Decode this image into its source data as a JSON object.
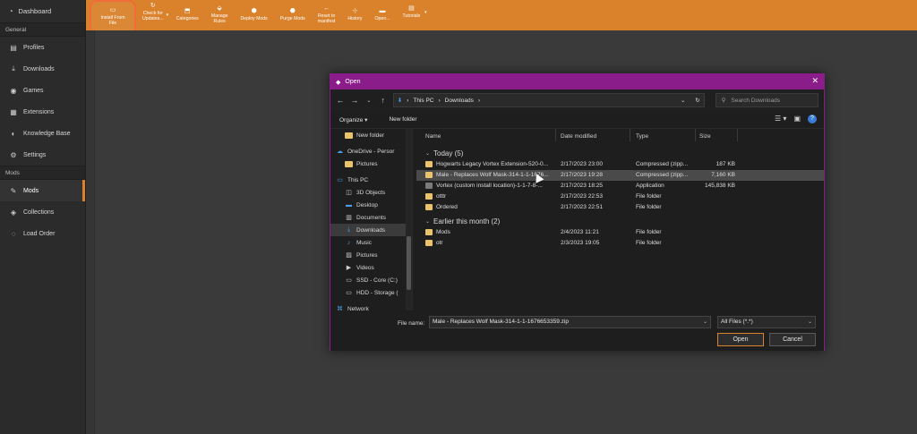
{
  "sidebar": {
    "top": "Dashboard",
    "general_label": "General",
    "general_items": [
      {
        "label": "Profiles",
        "icon": "profiles-icon"
      },
      {
        "label": "Downloads",
        "icon": "downloads-icon"
      },
      {
        "label": "Games",
        "icon": "games-icon"
      },
      {
        "label": "Extensions",
        "icon": "extensions-icon"
      },
      {
        "label": "Knowledge Base",
        "icon": "knowledge-icon"
      },
      {
        "label": "Settings",
        "icon": "gear-icon"
      }
    ],
    "mods_label": "Mods",
    "mods_items": [
      {
        "label": "Mods",
        "icon": "wrench-icon",
        "active": true
      },
      {
        "label": "Collections",
        "icon": "collections-icon"
      },
      {
        "label": "Load Order",
        "icon": "load-order-icon"
      }
    ]
  },
  "toolbar": {
    "buttons": [
      {
        "line1": "Install From",
        "line2": "File"
      },
      {
        "line1": "Check for",
        "line2": "Updates..."
      },
      {
        "line1": "Categories",
        "line2": ""
      },
      {
        "line1": "Manage",
        "line2": "Rules"
      },
      {
        "line1": "Deploy Mods",
        "line2": ""
      },
      {
        "line1": "Purge Mods",
        "line2": ""
      },
      {
        "line1": "Reset to",
        "line2": "manifest"
      },
      {
        "line1": "History",
        "line2": ""
      },
      {
        "line1": "Open...",
        "line2": ""
      },
      {
        "line1": "Tutorials",
        "line2": ""
      }
    ],
    "accent": "#d9822b"
  },
  "dialog": {
    "title": "Open",
    "address": [
      "This PC",
      "Downloads"
    ],
    "search_placeholder": "Search Downloads",
    "organize": "Organize",
    "new_folder": "New folder",
    "tree": [
      {
        "label": "New folder",
        "icon": "folder-icon"
      },
      {
        "label": "OneDrive - Persor",
        "icon": "onedrive-icon"
      },
      {
        "label": "Pictures",
        "icon": "folder-icon"
      },
      {
        "label": "This PC",
        "icon": "pc-icon"
      },
      {
        "label": "3D Objects",
        "icon": "objects-icon"
      },
      {
        "label": "Desktop",
        "icon": "desktop-icon"
      },
      {
        "label": "Documents",
        "icon": "documents-icon"
      },
      {
        "label": "Downloads",
        "icon": "downloads-icon",
        "selected": true
      },
      {
        "label": "Music",
        "icon": "music-icon"
      },
      {
        "label": "Pictures",
        "icon": "pictures-icon"
      },
      {
        "label": "Videos",
        "icon": "videos-icon"
      },
      {
        "label": "SSD - Core (C:)",
        "icon": "drive-icon"
      },
      {
        "label": "HDD - Storage (",
        "icon": "drive-icon"
      },
      {
        "label": "Network",
        "icon": "network-icon"
      }
    ],
    "columns": {
      "name": "Name",
      "date": "Date modified",
      "type": "Type",
      "size": "Size"
    },
    "groups": [
      {
        "label": "Today (5)",
        "files": [
          {
            "name": "Hogwarts Legacy Vortex Extension-520-0...",
            "date": "2/17/2023 23:00",
            "type": "Compressed (zipp...",
            "size": "187 KB",
            "icon": "zip-icon"
          },
          {
            "name": "Male - Replaces Wolf Mask-314-1-1-1676...",
            "date": "2/17/2023 19:28",
            "type": "Compressed (zipp...",
            "size": "7,160 KB",
            "icon": "zip-icon",
            "selected": true
          },
          {
            "name": "Vortex (custom install location)-1-1-7-8-...",
            "date": "2/17/2023 18:25",
            "type": "Application",
            "size": "145,838 KB",
            "icon": "app-icon"
          },
          {
            "name": "otttr",
            "date": "2/17/2023 22:53",
            "type": "File folder",
            "size": "",
            "icon": "folder-icon"
          },
          {
            "name": "Ordered",
            "date": "2/17/2023 22:51",
            "type": "File folder",
            "size": "",
            "icon": "folder-icon"
          }
        ]
      },
      {
        "label": "Earlier this month (2)",
        "files": [
          {
            "name": "Mods",
            "date": "2/4/2023 11:21",
            "type": "File folder",
            "size": "",
            "icon": "folder-icon"
          },
          {
            "name": "otr",
            "date": "2/3/2023 19:05",
            "type": "File folder",
            "size": "",
            "icon": "folder-icon"
          }
        ]
      }
    ],
    "filename_label": "File name:",
    "filename_value": "Male - Replaces Wolf Mask-314-1-1-1676653359.zip",
    "filetype": "All Files (*.*)",
    "open_label": "Open",
    "cancel_label": "Cancel",
    "accent": "#8a1d8a"
  }
}
